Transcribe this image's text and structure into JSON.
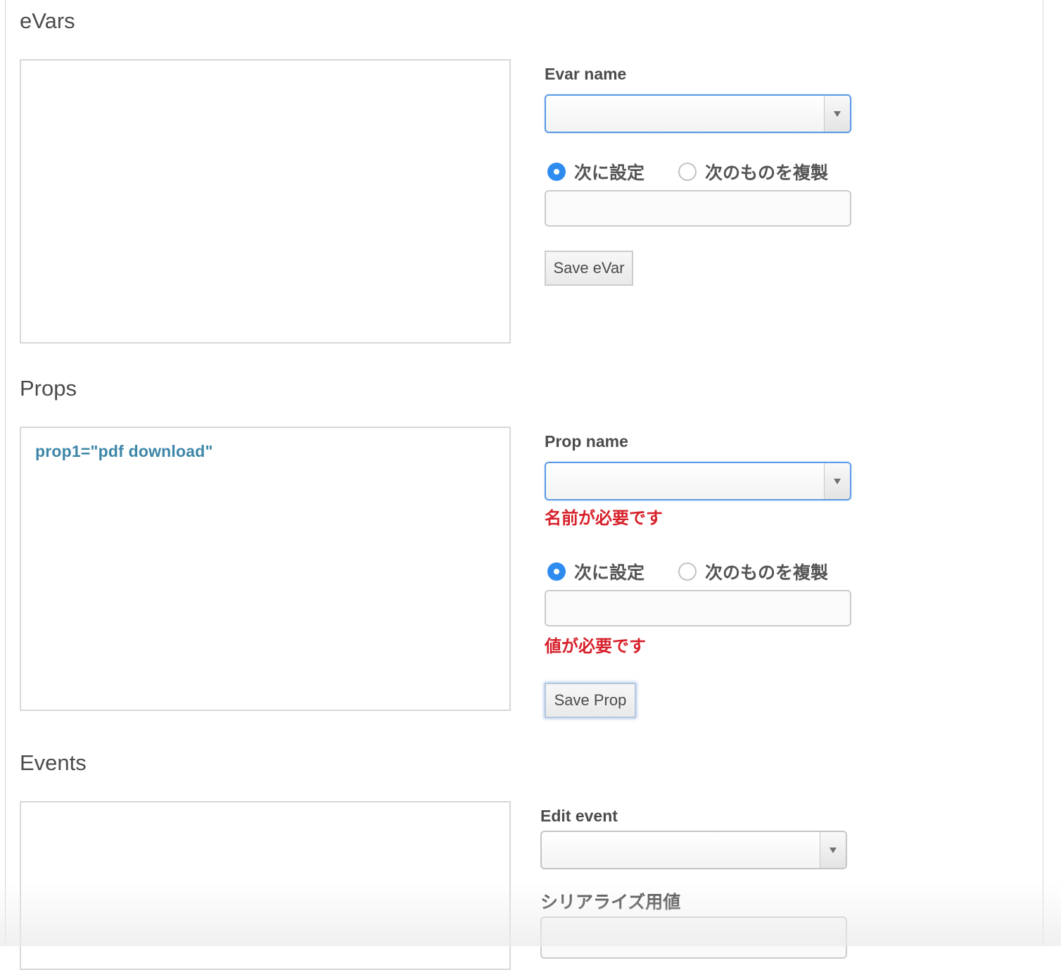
{
  "evars": {
    "title": "eVars",
    "field_label": "Evar name",
    "select_value": "",
    "radio_set_label": "次に設定",
    "radio_copy_label": "次のものを複製",
    "value_input": "",
    "save_label": "Save eVar"
  },
  "props": {
    "title": "Props",
    "list_items": [
      "prop1=\"pdf download\""
    ],
    "field_label": "Prop name",
    "select_value": "",
    "name_error": "名前が必要です",
    "radio_set_label": "次に設定",
    "radio_copy_label": "次のものを複製",
    "value_input": "",
    "value_error": "値が必要です",
    "save_label": "Save Prop"
  },
  "events": {
    "title": "Events",
    "field_label": "Edit event",
    "select_value": "",
    "serialize_label": "シリアライズ用値",
    "serialize_input": ""
  },
  "colors": {
    "accent_blue": "#2e8cf0",
    "focus_border": "#5b9ae6",
    "error_red": "#d7202a",
    "list_text": "#3d86a8"
  }
}
